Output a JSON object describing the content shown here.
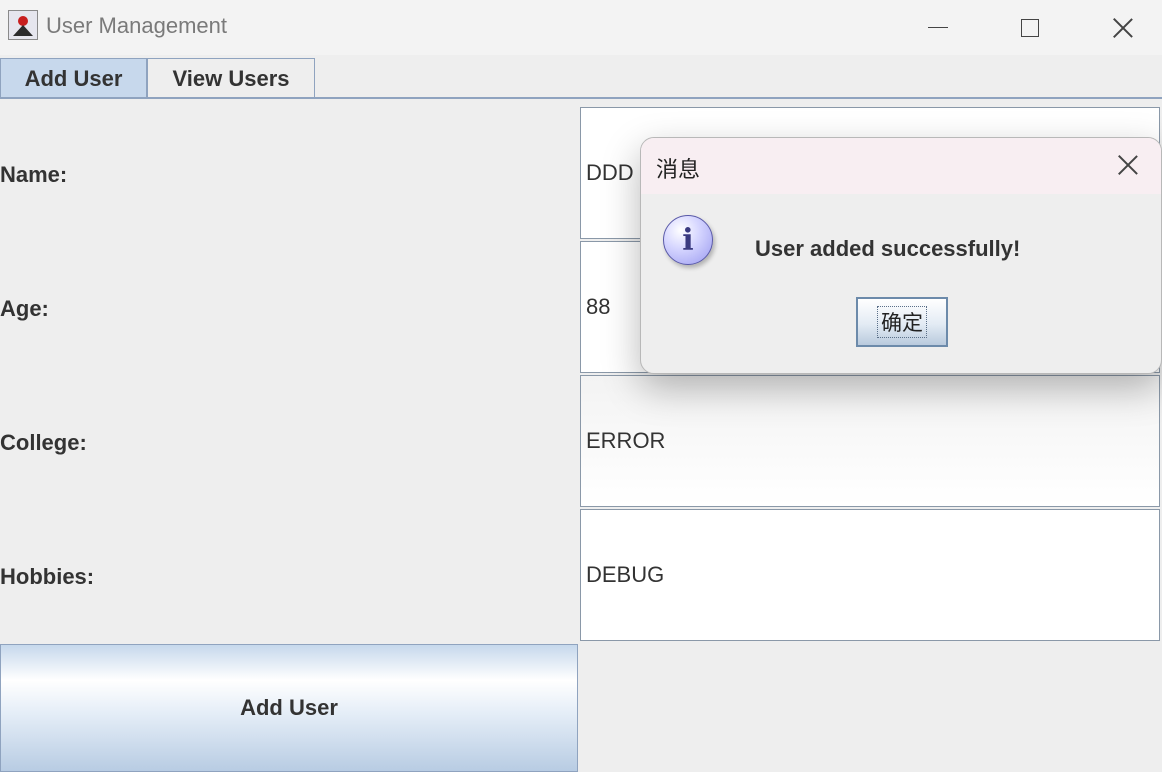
{
  "window": {
    "title": "User Management"
  },
  "tabs": [
    {
      "label": "Add User",
      "selected": true
    },
    {
      "label": "View Users",
      "selected": false
    }
  ],
  "form": {
    "name_label": "Name:",
    "name_value": "DDD",
    "age_label": "Age:",
    "age_value": "88",
    "college_label": "College:",
    "college_value": "ERROR",
    "hobbies_label": "Hobbies:",
    "hobbies_value": "DEBUG",
    "submit_label": "Add User"
  },
  "dialog": {
    "title": "消息",
    "icon": "info-icon",
    "icon_glyph": "i",
    "message": "User added successfully!",
    "ok_label": "确定"
  },
  "colors": {
    "tab_selected": "#c7d8ec",
    "accent_border": "#8fa3bf",
    "dialog_titlebar": "#f8eef2"
  }
}
